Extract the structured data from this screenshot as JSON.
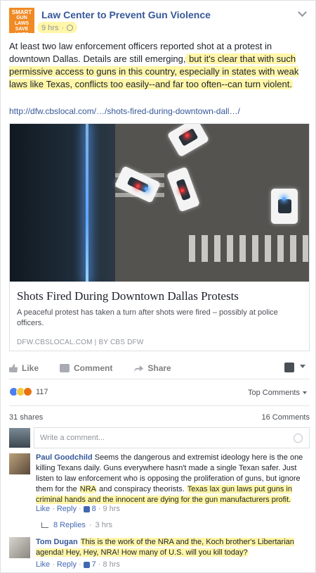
{
  "post": {
    "page_name": "Law Center to Prevent Gun Violence",
    "avatar_lines": [
      "SMART",
      "GUN LAWS",
      "SAVE LIVES"
    ],
    "time": "9 hrs",
    "text_part1": "At least two law enforcement officers reported shot at a protest in downtown Dallas. Details are still emerging,",
    "text_part2": " but it's clear that with such permissive access to guns in this country, especially in states with weak laws like Texas, conflicts too easily--and far too often--can turn violent.",
    "link": "http://dfw.cbslocal.com/…/shots-fired-during-downtown-dall…/"
  },
  "preview": {
    "title": "Shots Fired During Downtown Dallas Protests",
    "description": "A peaceful protest has taken a turn after shots were fired – possibly at police officers.",
    "source_domain": "DFW.CBSLOCAL.COM",
    "source_sep": "|",
    "source_by": "BY",
    "source_name": "CBS DFW"
  },
  "actions": {
    "like": "Like",
    "comment": "Comment",
    "share": "Share"
  },
  "reactions": {
    "count": "117",
    "sort_label": "Top Comments"
  },
  "counts": {
    "shares": "31 shares",
    "comments": "16 Comments"
  },
  "composer": {
    "placeholder": "Write a comment..."
  },
  "comments": [
    {
      "author": "Paul Goodchild",
      "text_a": "Seems the dangerous and extremist ideology here is the one killing Texans daily. Guns everywhere hasn't made a single Texan safer. Just listen to law enforcement who is opposing the proliferation of guns, but ignore them for the ",
      "text_hl1": "NRA",
      "text_b": " and conspiracy theorists. ",
      "text_hl2": "Texas lax gun laws put guns in criminal hands and the innocent are dying for the gun manufacturers profit.",
      "like_label": "Like",
      "reply_label": "Reply",
      "likes": "8",
      "time": "9 hrs",
      "replies": "8 Replies",
      "replies_time": "3 hrs"
    },
    {
      "author": "Tom Dugan",
      "text_hl": "This is the work of the NRA and the, Koch brother's Libertarian agenda! Hey, Hey, NRA! How many of U.S. will you kill today?",
      "like_label": "Like",
      "reply_label": "Reply",
      "likes": "7",
      "time": "8 hrs"
    }
  ],
  "colors": {
    "link_blue": "#365899",
    "highlight": "#fff6a8",
    "org_orange": "#f08a24"
  }
}
